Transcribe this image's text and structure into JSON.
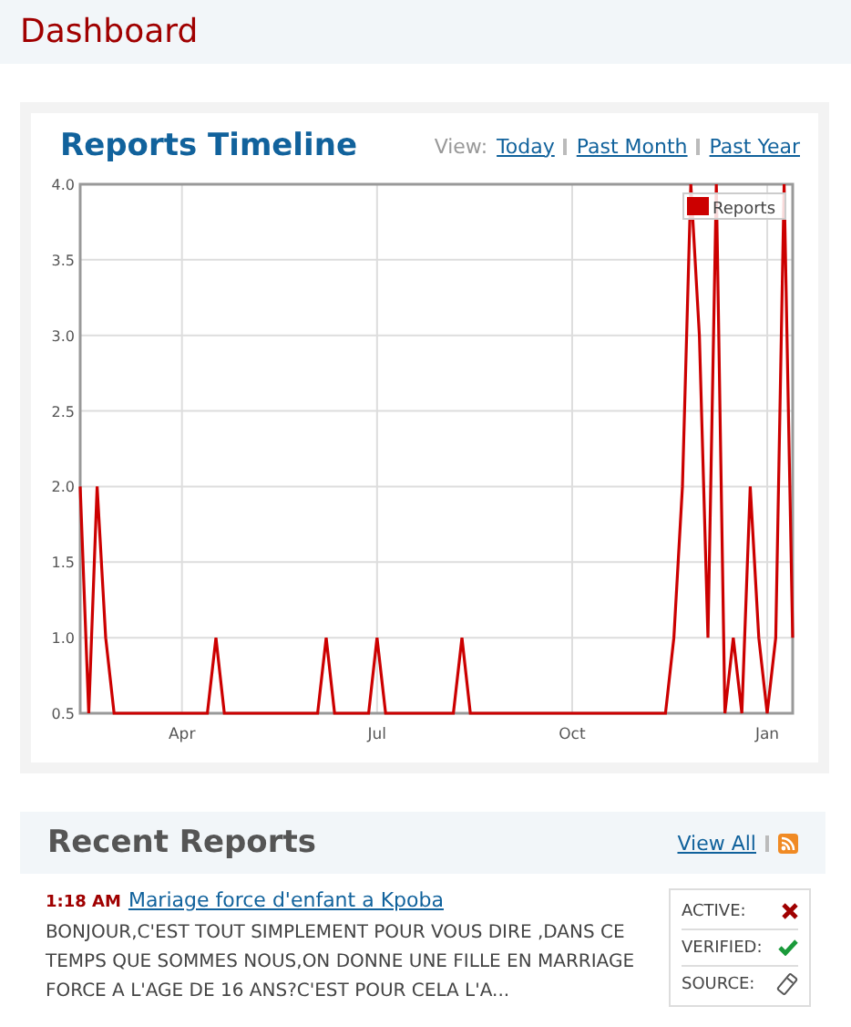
{
  "page": {
    "title": "Dashboard"
  },
  "timeline": {
    "title": "Reports Timeline",
    "view_label": "View:",
    "view_links": [
      {
        "label": "Today"
      },
      {
        "label": "Past Month"
      },
      {
        "label": "Past Year"
      }
    ],
    "chart_data": {
      "type": "line",
      "grid": true,
      "ylim": [
        0.5,
        4
      ],
      "yticks": [
        0.5,
        {
          "value": 1,
          "label": "1.0"
        },
        1.5,
        {
          "value": 2,
          "label": "2.0"
        },
        2.5,
        {
          "value": 3,
          "label": "3.0"
        },
        3.5,
        {
          "value": 4,
          "label": "4.0"
        }
      ],
      "categories": [
        null,
        null,
        null,
        null,
        null,
        null,
        null,
        null,
        null,
        null,
        null,
        null,
        "Apr",
        null,
        null,
        null,
        null,
        null,
        null,
        null,
        null,
        null,
        null,
        null,
        null,
        null,
        null,
        null,
        null,
        null,
        null,
        null,
        null,
        null,
        null,
        "Jul",
        null,
        null,
        null,
        null,
        null,
        null,
        null,
        null,
        null,
        null,
        null,
        null,
        null,
        null,
        null,
        null,
        null,
        null,
        null,
        null,
        null,
        null,
        "Oct",
        null,
        null,
        null,
        null,
        null,
        null,
        null,
        null,
        null,
        null,
        null,
        null,
        null,
        null,
        null,
        null,
        null,
        null,
        null,
        null,
        null,
        null,
        "Jan",
        null,
        null,
        null
      ],
      "series": [
        {
          "name": "Reports",
          "color": "#cc0000",
          "values": [
            2,
            0.5,
            2,
            1,
            0.5,
            0.5,
            0.5,
            0.5,
            0.5,
            0.5,
            0.5,
            0.5,
            0.5,
            0.5,
            0.5,
            0.5,
            1,
            0.5,
            0.5,
            0.5,
            0.5,
            0.5,
            0.5,
            0.5,
            0.5,
            0.5,
            0.5,
            0.5,
            0.5,
            1,
            0.5,
            0.5,
            0.5,
            0.5,
            0.5,
            1,
            0.5,
            0.5,
            0.5,
            0.5,
            0.5,
            0.5,
            0.5,
            0.5,
            0.5,
            1,
            0.5,
            0.5,
            0.5,
            0.5,
            0.5,
            0.5,
            0.5,
            0.5,
            0.5,
            0.5,
            0.5,
            0.5,
            0.5,
            0.5,
            0.5,
            0.5,
            0.5,
            0.5,
            0.5,
            0.5,
            0.5,
            0.5,
            0.5,
            0.5,
            1,
            2,
            4,
            3,
            1,
            4,
            0.5,
            1,
            0.5,
            2,
            1,
            0.5,
            1,
            4,
            1
          ]
        }
      ]
    }
  },
  "recent": {
    "title": "Recent Reports",
    "view_all": "View All",
    "reports": [
      {
        "time": "1:18 AM",
        "title": "Mariage force d'enfant a Kpoba",
        "text": "BONJOUR,C'EST TOUT SIMPLEMENT POUR VOUS DIRE ,DANS CE TEMPS QUE SOMMES NOUS,ON DONNE UNE FILLE EN MARRIAGE FORCE A L'AGE DE 16 ANS?C'EST POUR CELA L'A...",
        "status": [
          {
            "label": "ACTIVE:",
            "kind": "flag",
            "on": false
          },
          {
            "label": "VERIFIED:",
            "kind": "flag",
            "on": true
          },
          {
            "label": "SOURCE:",
            "kind": "phone"
          }
        ]
      }
    ]
  }
}
